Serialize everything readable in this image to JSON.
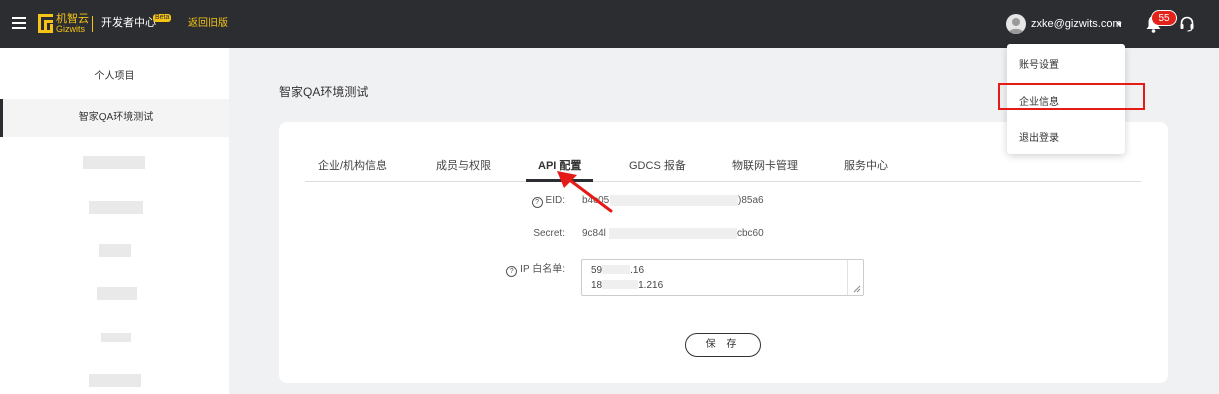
{
  "header": {
    "logo_cn": "机智云",
    "logo_en": "Gizwits",
    "dev_center": "开发者中心",
    "beta_badge": "Beta",
    "back_old_version": "返回旧版",
    "user_email": "zxke@gizwits.com",
    "caret": "▾",
    "notification_count": "55",
    "icons": [
      "menu-icon",
      "gizwits-logo",
      "avatar",
      "bell-icon",
      "headset-icon"
    ]
  },
  "sidebar": {
    "personal_project": "个人项目",
    "active_project": "智家QA环境测试"
  },
  "main": {
    "page_title": "智家QA环境测试",
    "tabs": [
      "企业/机构信息",
      "成员与权限",
      "API 配置",
      "GDCS 报备",
      "物联网卡管理",
      "服务中心"
    ],
    "active_tab": "API 配置",
    "fields": {
      "eid_label": "EID:",
      "eid_prefix": "b4c05",
      "eid_suffix": ")85a6",
      "secret_label": "Secret:",
      "secret_prefix": "9c84l",
      "secret_suffix": "cbc60",
      "ip_label": "IP 白名单:",
      "ip_line1_prefix": "59",
      "ip_line1_suffix": ".16",
      "ip_line2_prefix": "18",
      "ip_line2_suffix": "1.216"
    },
    "help_glyph": "?",
    "save_button": "保 存"
  },
  "dropdown": {
    "items": [
      "账号设置",
      "企业信息",
      "退出登录"
    ],
    "highlighted": "企业信息"
  },
  "colors": {
    "topbar": "#2b2d31",
    "brand_yellow": "#f5c417",
    "annotation_red": "#e41b17",
    "badge_red": "#e2231a"
  }
}
